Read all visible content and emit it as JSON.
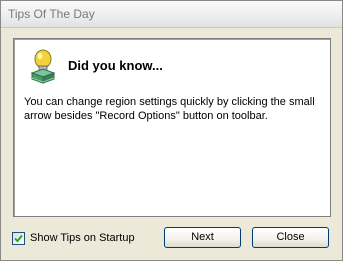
{
  "window": {
    "title": "Tips Of The Day"
  },
  "tip": {
    "heading": "Did you know...",
    "text": "You can change region settings quickly by clicking the small arrow besides \"Record Options\" button on toolbar.",
    "icon": "lightbulb-icon"
  },
  "footer": {
    "show_tips_label": "Show Tips on Startup",
    "show_tips_checked": true,
    "next_label": "Next",
    "close_label": "Close"
  },
  "colors": {
    "window_bg": "#ece9d8",
    "panel_bg": "#ffffff",
    "button_border": "#003c74",
    "bulb_yellow": "#f2d23a",
    "base_green": "#4c9a6a"
  }
}
